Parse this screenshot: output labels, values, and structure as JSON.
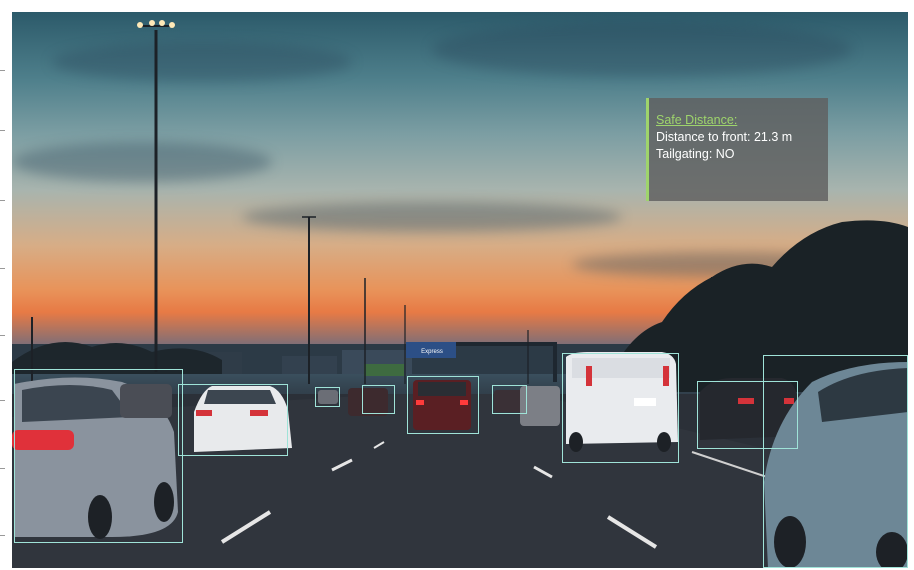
{
  "hud": {
    "title": "Safe Distance:",
    "distance_line": "Distance to front: 21.3 m",
    "tailgating_line": "Tailgating: NO",
    "accent_color": "#9ed46c",
    "panel_color": "#5f5f5f"
  },
  "detections": {
    "box_color": "#9fe3d8",
    "label": "vehicle",
    "count": 11
  },
  "scene": {
    "overhead_sign_text": "Express"
  }
}
